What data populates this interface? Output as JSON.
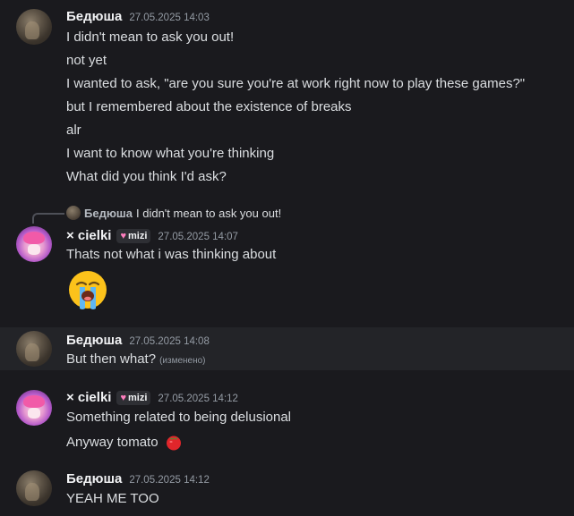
{
  "users": {
    "bedusha": "Бедюша",
    "cielki": "× cielki",
    "tag": "mizi"
  },
  "group1": {
    "time": "27.05.2025 14:03",
    "messages": [
      "I didn't mean to ask you out!",
      "not yet",
      "I wanted to ask, \"are you sure you're at work right now to play these games?\"",
      "but I remembered about the existence of breaks",
      "alr",
      "I want to know what you're thinking",
      "What did you think I'd ask?"
    ]
  },
  "reply": {
    "name": "Бедюша",
    "text": "I didn't mean to ask you out!"
  },
  "group2": {
    "time": "27.05.2025 14:07",
    "messages": [
      "Thats not what i was thinking about"
    ],
    "emoji": "loudly-crying-face"
  },
  "group3": {
    "time": "27.05.2025 14:08",
    "messages": [
      "But then what?"
    ],
    "edited": "(изменено)"
  },
  "group4": {
    "time": "27.05.2025 14:12",
    "messages": [
      "Something related to being delusional",
      "Anyway tomato"
    ]
  },
  "group5": {
    "time": "27.05.2025 14:12",
    "messages": [
      "YEAH ME TOO"
    ]
  },
  "colors": {
    "background": "#1a1a1e",
    "highlight": "#232428",
    "text": "#dbdee1",
    "muted": "#949ba4"
  }
}
